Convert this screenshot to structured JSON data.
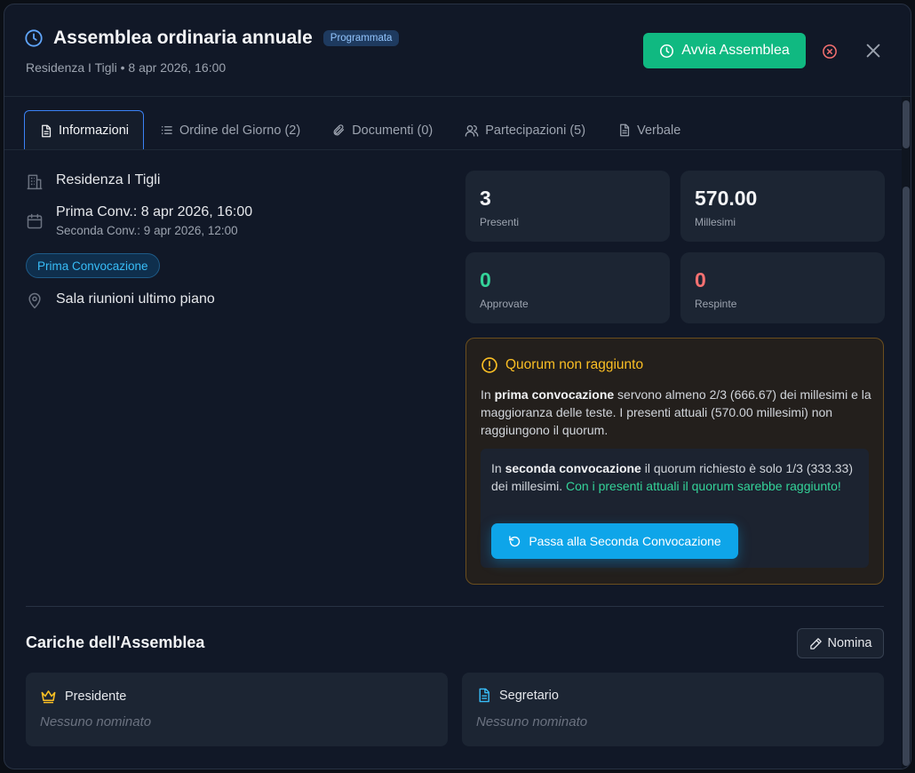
{
  "header": {
    "title": "Assemblea ordinaria annuale",
    "status": "Programmata",
    "subtitle": "Residenza I Tigli • 8 apr 2026, 16:00",
    "start_label": "Avvia Assemblea",
    "icons": {
      "title": "clock-icon",
      "start": "clock-icon",
      "cancel": "x-circle-icon",
      "close": "close-icon"
    }
  },
  "tabs": [
    {
      "label": "Informazioni",
      "icon": "document-icon",
      "active": true
    },
    {
      "label": "Ordine del Giorno (2)",
      "icon": "list-icon",
      "active": false
    },
    {
      "label": "Documenti (0)",
      "icon": "paperclip-icon",
      "active": false
    },
    {
      "label": "Partecipazioni (5)",
      "icon": "users-icon",
      "active": false
    },
    {
      "label": "Verbale",
      "icon": "file-icon",
      "active": false
    }
  ],
  "info": {
    "building": "Residenza I Tigli",
    "first_conv": "Prima Conv.: 8 apr 2026, 16:00",
    "second_conv": "Seconda Conv.: 9 apr 2026, 12:00",
    "conv_badge": "Prima Convocazione",
    "location": "Sala riunioni ultimo piano"
  },
  "stats": [
    {
      "value": "3",
      "label": "Presenti"
    },
    {
      "value": "570.00",
      "label": "Millesimi"
    },
    {
      "value": "0",
      "label": "Approvate",
      "color": "#34d399"
    },
    {
      "value": "0",
      "label": "Respinte",
      "color": "#f87171"
    }
  ],
  "quorum": {
    "title": "Quorum non raggiunto",
    "p1_pre": "In ",
    "p1_bold": "prima convocazione",
    "p1_post": " servono almeno 2/3 (666.67) dei millesimi e la maggioranza delle teste. I presenti attuali (570.00 millesimi) non raggiungono il quorum.",
    "p2_pre": "In ",
    "p2_bold": "seconda convocazione",
    "p2_post": " il quorum richiesto è solo 1/3 (333.33) dei millesimi. ",
    "p2_ok": "Con i presenti attuali il quorum sarebbe raggiunto!",
    "button_label": "Passa alla Seconda Convocazione",
    "colors": {
      "warning": "#fbbf24",
      "success": "#34d399",
      "button": "#0ea5e9"
    }
  },
  "roles": {
    "section_title": "Cariche dell'Assemblea",
    "nomina_label": "Nomina",
    "president": {
      "label": "Presidente",
      "value": "Nessuno nominato",
      "icon": "crown-icon"
    },
    "secretary": {
      "label": "Segretario",
      "value": "Nessuno nominato",
      "icon": "document-icon"
    }
  }
}
